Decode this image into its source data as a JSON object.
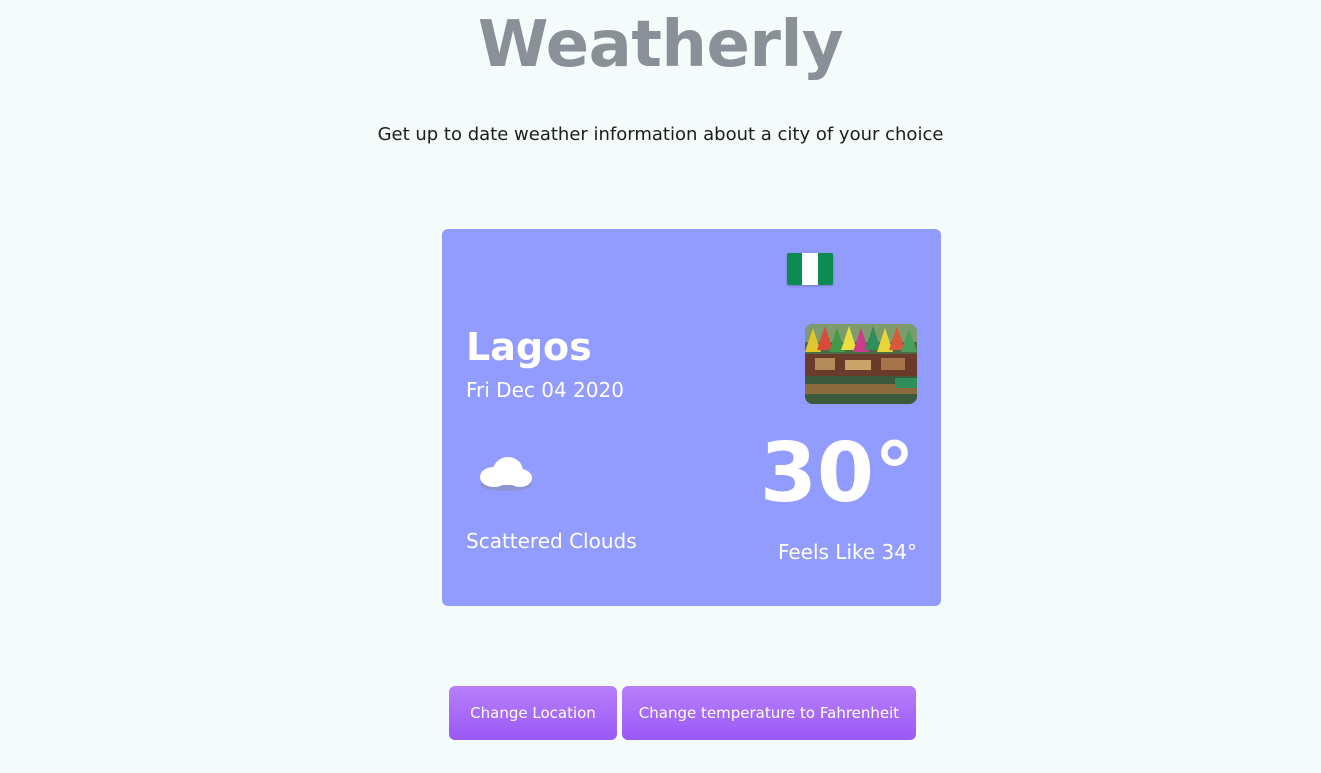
{
  "header": {
    "title": "Weatherly",
    "tagline": "Get up to date weather information about a city of your choice"
  },
  "card": {
    "city": "Lagos",
    "date": "Fri Dec 04 2020",
    "condition": "Scattered Clouds",
    "temperature": "30°",
    "feels_like": "Feels Like 34°",
    "weather_icon": "cloud-icon",
    "country_flag": "nigeria-flag-icon",
    "flag_colors": [
      "#008751",
      "#ffffff",
      "#008751"
    ],
    "background_color": "#929cfe"
  },
  "actions": {
    "change_location_label": "Change Location",
    "change_unit_label": "Change temperature to Fahrenheit"
  },
  "colors": {
    "page_background": "#f3fcfa",
    "title": "#8b8f98",
    "button_top": "#b77ffb",
    "button_bottom": "#9a58f5"
  }
}
